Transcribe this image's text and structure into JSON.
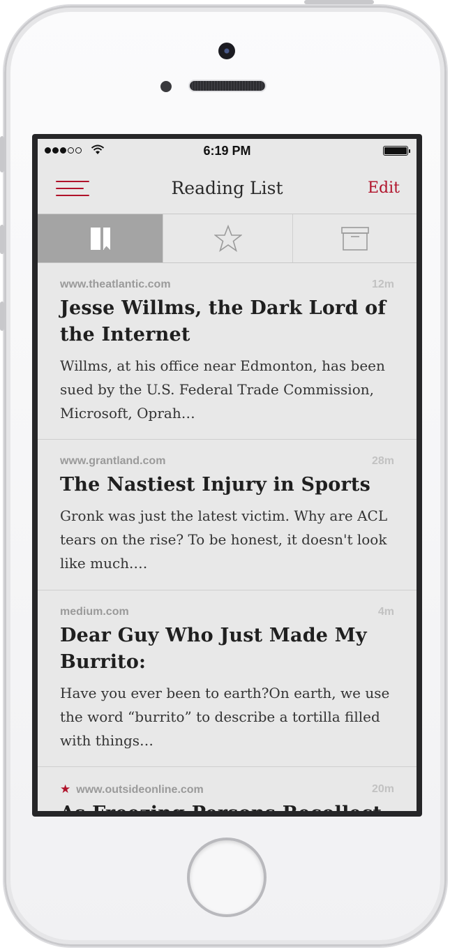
{
  "status_bar": {
    "time": "6:19 PM",
    "signal_bars": 3,
    "signal_total": 5
  },
  "nav": {
    "title": "Reading List",
    "edit_label": "Edit"
  },
  "tabs": [
    {
      "icon": "bookmark-icon",
      "active": true
    },
    {
      "icon": "star-icon",
      "active": false
    },
    {
      "icon": "archive-icon",
      "active": false
    }
  ],
  "articles": [
    {
      "domain": "www.theatlantic.com",
      "age": "12m",
      "starred": false,
      "title": "Jesse Willms, the Dark Lord of the Internet",
      "excerpt": "Willms, at his office near Edmonton, has been sued by the U.S. Federal Trade Commission, Microsoft, Oprah…"
    },
    {
      "domain": "www.grantland.com",
      "age": "28m",
      "starred": false,
      "title": "The Nastiest Injury in Sports",
      "excerpt": "Gronk was just the latest victim. Why are ACL tears on the rise? To be honest, it doesn't look like much.…"
    },
    {
      "domain": "medium.com",
      "age": "4m",
      "starred": false,
      "title": "Dear Guy Who Just Made My Burrito:",
      "excerpt": "Have you ever been to earth?On earth, we use the word “burrito” to describe a tortilla filled with things…"
    },
    {
      "domain": "www.outsideonline.com",
      "age": "20m",
      "starred": true,
      "title": "As Freezing Persons Recollect",
      "excerpt": ""
    }
  ],
  "colors": {
    "accent": "#b0122a",
    "background": "#e8e8e8",
    "active_tab": "#a4a4a4"
  }
}
